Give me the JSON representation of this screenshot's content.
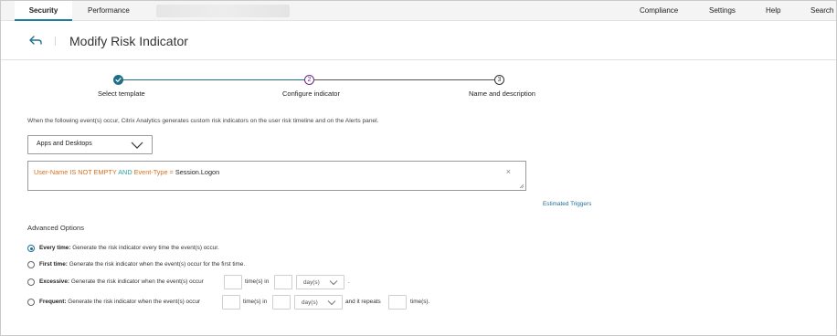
{
  "nav": {
    "tabs": [
      "Security",
      "Performance"
    ],
    "right_links": [
      "Compliance",
      "Settings",
      "Help",
      "Search"
    ]
  },
  "header": {
    "title": "Modify Risk Indicator"
  },
  "stepper": {
    "steps": [
      {
        "label": "Select template",
        "number": "",
        "state": "done"
      },
      {
        "label": "Configure indicator",
        "number": "2",
        "state": "current"
      },
      {
        "label": "Name and description",
        "number": "3",
        "state": "pending"
      }
    ]
  },
  "intro_text": "When the following event(s) occur, Citrix Analytics generates custom risk indicators on the user risk timeline and on the Alerts panel.",
  "source_select": {
    "value": "Apps and Desktops"
  },
  "query": {
    "part1": "User-Name IS NOT EMPTY",
    "part2": "AND",
    "part3": "Event-Type =",
    "part4": "Session.Logon",
    "clear_icon": "×"
  },
  "estimated_triggers": "Estimated Triggers",
  "advanced": {
    "heading": "Advanced Options",
    "options": [
      {
        "key": "Every time:",
        "text": "Generate the risk indicator every time the event(s) occur.",
        "selected": true
      },
      {
        "key": "First time:",
        "text": "Generate the risk indicator when the event(s) occur for the first time.",
        "selected": false
      },
      {
        "key": "Excessive:",
        "text": "Generate the risk indicator when the event(s) occur",
        "selected": false
      },
      {
        "key": "Frequent:",
        "text": "Generate the risk indicator when the event(s) occur",
        "selected": false
      }
    ],
    "times_in": "time(s) in",
    "unit": "day(s)",
    "period": ".",
    "and_repeats": "and it repeats",
    "times": "time(s)."
  },
  "colors": {
    "accent": "#1e6f94",
    "step_done": "#1f6f86",
    "step_current": "#6b2a86",
    "query_orange": "#d8701f",
    "query_teal": "#28a3a7"
  }
}
